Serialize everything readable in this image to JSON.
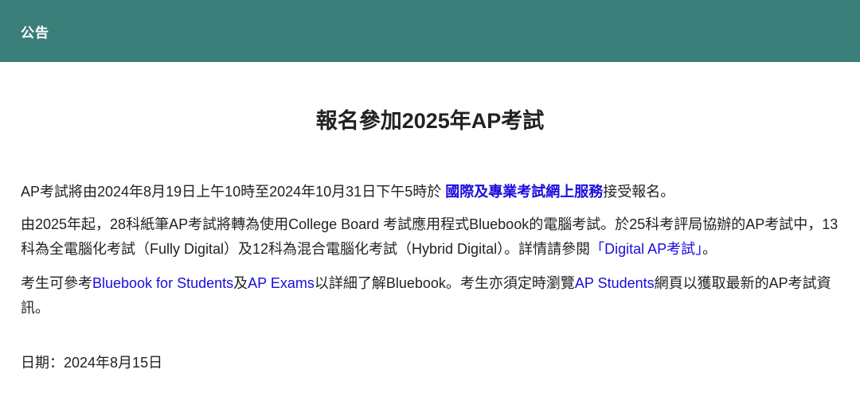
{
  "header": {
    "title": "公告"
  },
  "main": {
    "title": "報名參加2025年AP考試",
    "p1": {
      "text_before": "AP考試將由2024年8月19日上午10時至2024年10月31日下午5時於 ",
      "link": "國際及專業考試網上服務",
      "text_after": "接受報名。"
    },
    "p2": {
      "text_before": "由2025年起，28科紙筆AP考試將轉為使用College Board 考試應用程式Bluebook的電腦考試。於25科考評局協辦的AP考試中，13科為全電腦化考試（Fully Digital）及12科為混合電腦化考試（Hybrid Digital）。詳情請參閱",
      "link": "「Digital AP考試」",
      "text_after": "。"
    },
    "p3": {
      "text1": "考生可參考",
      "link1": "Bluebook for Students",
      "text2": "及",
      "link2": "AP Exams",
      "text3": "以詳細了解Bluebook。考生亦須定時瀏覽",
      "link3": "AP Students",
      "text4": "網頁以獲取最新的AP考試資訊。"
    },
    "date": "日期：2024年8月15日"
  },
  "colors": {
    "header_bg": "#3a7f7a",
    "link": "#1a0dde"
  }
}
